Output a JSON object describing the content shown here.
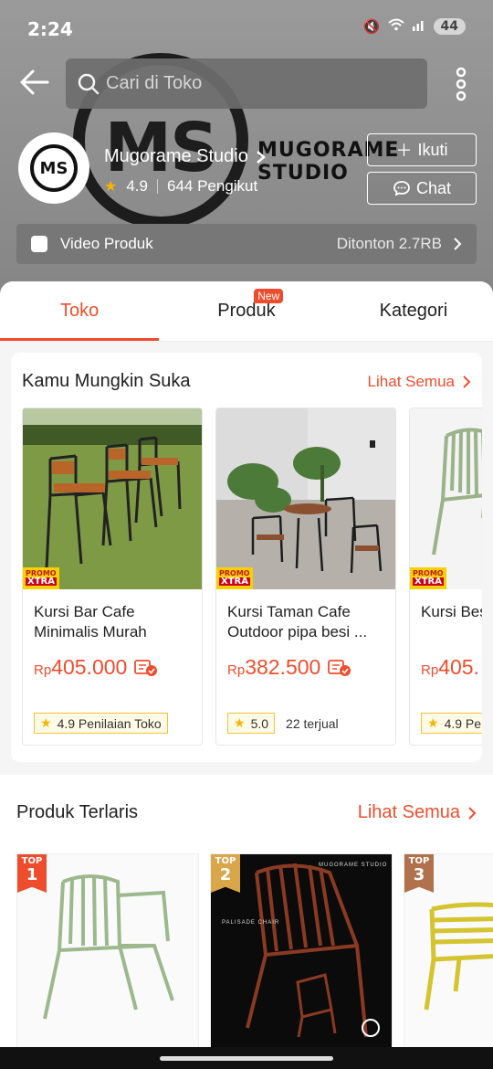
{
  "status_bar": {
    "time": "2:24",
    "battery": "44"
  },
  "header": {
    "search_placeholder": "Cari di Toko",
    "shop_name": "Mugorame Studio",
    "rating": "4.9",
    "followers": "644 Pengikut",
    "follow_label": "Ikuti",
    "chat_label": "Chat",
    "banner_logo_text": "MS",
    "banner_text": "MUGORAME STUDIO",
    "avatar_text": "MS"
  },
  "video_bar": {
    "label": "Video Produk",
    "views": "Ditonton 2.7RB"
  },
  "tabs": [
    {
      "label": "Toko",
      "active": true
    },
    {
      "label": "Produk",
      "badge": "New"
    },
    {
      "label": "Kategori"
    }
  ],
  "recommend": {
    "title": "Kamu Mungkin Suka",
    "see_all": "Lihat Semua",
    "items": [
      {
        "name": "Kursi Bar Cafe Minimalis Murah",
        "currency": "Rp",
        "price": "405.000",
        "chip": "4.9 Penilaian Toko",
        "sold": ""
      },
      {
        "name": "Kursi Taman Cafe Outdoor pipa besi ...",
        "currency": "Rp",
        "price": "382.500",
        "chip": "5.0",
        "sold": "22 terjual"
      },
      {
        "name": "Kursi Besi Armrest",
        "currency": "Rp",
        "price": "405.",
        "chip": "4.9 Pe",
        "sold": ""
      }
    ],
    "promo_top": "PROMO",
    "promo_bottom": "XTRA"
  },
  "bestseller": {
    "title": "Produk Terlaris",
    "see_all": "Lihat Semua",
    "badges": [
      {
        "top": "TOP",
        "num": "1"
      },
      {
        "top": "TOP",
        "num": "2"
      },
      {
        "top": "TOP",
        "num": "3"
      }
    ],
    "card2_brand": "MUGORAME STUDIO",
    "card2_caption": "PALISADE CHAIR"
  },
  "colors": {
    "accent": "#ee4d2d",
    "star": "#f5b400"
  }
}
